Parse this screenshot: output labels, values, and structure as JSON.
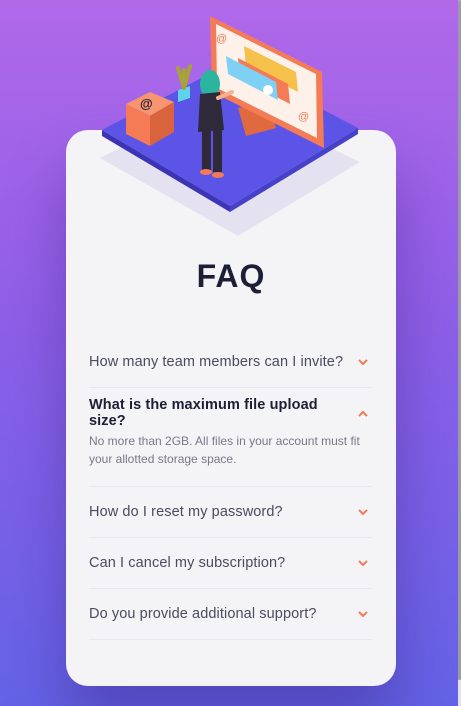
{
  "page": {
    "title": "FAQ"
  },
  "colors": {
    "bg_top": "#b068e9",
    "bg_bottom": "#6463e7",
    "card": "#f4f4f6",
    "heading": "#1e1f36",
    "accent": "#f47b56"
  },
  "faq": {
    "items": [
      {
        "question": "How many team members can I invite?",
        "answer": "",
        "open": false
      },
      {
        "question": "What is the maximum file upload size?",
        "answer": "No more than 2GB. All files in your account must fit your allotted storage space.",
        "open": true
      },
      {
        "question": "How do I reset my password?",
        "answer": "",
        "open": false
      },
      {
        "question": "Can I cancel my subscription?",
        "answer": "",
        "open": false
      },
      {
        "question": "Do you provide additional support?",
        "answer": "",
        "open": false
      }
    ]
  },
  "icons": {
    "expand": "chevron-down-icon",
    "collapse": "chevron-up-icon",
    "email": "at-sign-icon"
  }
}
